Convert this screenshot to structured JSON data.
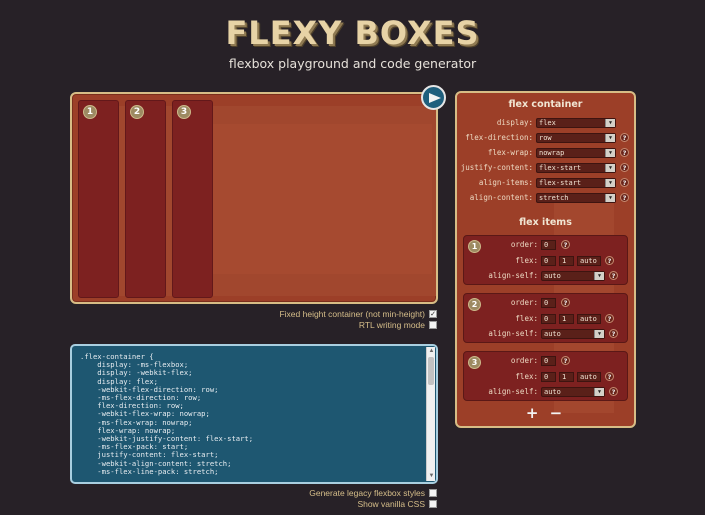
{
  "header": {
    "title": "FLEXY BOXES",
    "subtitle": "flexbox playground and code generator"
  },
  "playground": {
    "items": [
      {
        "number": "1"
      },
      {
        "number": "2"
      },
      {
        "number": "3"
      }
    ],
    "play_icon": "play-icon"
  },
  "options_top": {
    "fixed_height_label": "Fixed height container (not min-height)",
    "fixed_height_checked": true,
    "rtl_label": "RTL writing mode",
    "rtl_checked": false
  },
  "code": {
    "lines": ".flex-container {\n    display: -ms-flexbox;\n    display: -webkit-flex;\n    display: flex;\n    -webkit-flex-direction: row;\n    -ms-flex-direction: row;\n    flex-direction: row;\n    -webkit-flex-wrap: nowrap;\n    -ms-flex-wrap: nowrap;\n    flex-wrap: nowrap;\n    -webkit-justify-content: flex-start;\n    -ms-flex-pack: start;\n    justify-content: flex-start;\n    -webkit-align-content: stretch;\n    -ms-flex-line-pack: stretch;"
  },
  "options_bottom": {
    "legacy_label": "Generate legacy flexbox styles",
    "legacy_checked": false,
    "vanilla_label": "Show vanilla CSS",
    "vanilla_checked": false
  },
  "container_panel": {
    "title": "flex container",
    "props": [
      {
        "label": "display:",
        "value": "flex"
      },
      {
        "label": "flex-direction:",
        "value": "row"
      },
      {
        "label": "flex-wrap:",
        "value": "nowrap"
      },
      {
        "label": "justify-content:",
        "value": "flex-start"
      },
      {
        "label": "align-items:",
        "value": "flex-start"
      },
      {
        "label": "align-content:",
        "value": "stretch"
      }
    ],
    "help": "?"
  },
  "items_panel": {
    "title": "flex items",
    "items": [
      {
        "number": "1",
        "order_label": "order:",
        "order": "0",
        "flex_label": "flex:",
        "grow": "0",
        "shrink": "1",
        "basis": "auto",
        "align_label": "align-self:",
        "align_self": "auto"
      },
      {
        "number": "2",
        "order_label": "order:",
        "order": "0",
        "flex_label": "flex:",
        "grow": "0",
        "shrink": "1",
        "basis": "auto",
        "align_label": "align-self:",
        "align_self": "auto"
      },
      {
        "number": "3",
        "order_label": "order:",
        "order": "0",
        "flex_label": "flex:",
        "grow": "0",
        "shrink": "1",
        "basis": "auto",
        "align_label": "align-self:",
        "align_self": "auto"
      }
    ],
    "add_remove": "+ −"
  }
}
